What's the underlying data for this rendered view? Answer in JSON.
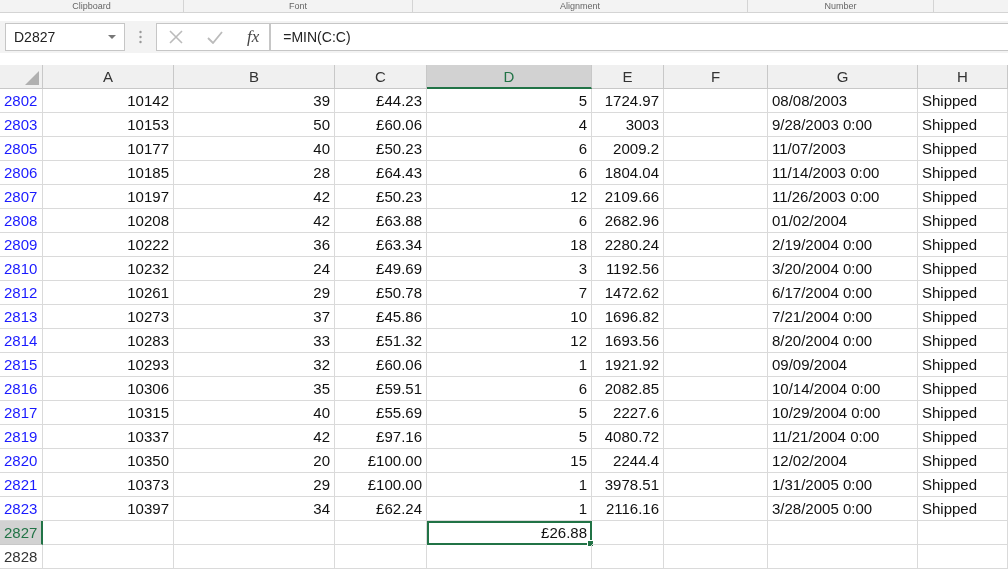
{
  "ribbon_groups": [
    "Clipboard",
    "Font",
    "Alignment",
    "Number"
  ],
  "formula_bar": {
    "name_box": "D2827",
    "function_label": "fx",
    "formula": "=MIN(C:C)"
  },
  "columns": [
    {
      "label": "A",
      "kind": "number",
      "selected": false
    },
    {
      "label": "B",
      "kind": "number",
      "selected": false
    },
    {
      "label": "C",
      "kind": "number",
      "selected": false
    },
    {
      "label": "D",
      "kind": "number",
      "selected": true
    },
    {
      "label": "E",
      "kind": "number",
      "selected": false
    },
    {
      "label": "F",
      "kind": "number",
      "selected": false
    },
    {
      "label": "G",
      "kind": "text",
      "selected": false
    },
    {
      "label": "H",
      "kind": "text",
      "selected": false
    }
  ],
  "rows": [
    {
      "header": "2802",
      "filtered": true,
      "selected": false,
      "cells": [
        "10142",
        "39",
        "£44.23",
        "5",
        "1724.97",
        null,
        "08/08/2003",
        "Shipped"
      ]
    },
    {
      "header": "2803",
      "filtered": true,
      "selected": false,
      "cells": [
        "10153",
        "50",
        "£60.06",
        "4",
        "3003",
        null,
        "9/28/2003 0:00",
        "Shipped"
      ]
    },
    {
      "header": "2805",
      "filtered": true,
      "selected": false,
      "cells": [
        "10177",
        "40",
        "£50.23",
        "6",
        "2009.2",
        null,
        "11/07/2003",
        "Shipped"
      ]
    },
    {
      "header": "2806",
      "filtered": true,
      "selected": false,
      "cells": [
        "10185",
        "28",
        "£64.43",
        "6",
        "1804.04",
        null,
        "11/14/2003 0:00",
        "Shipped"
      ]
    },
    {
      "header": "2807",
      "filtered": true,
      "selected": false,
      "cells": [
        "10197",
        "42",
        "£50.23",
        "12",
        "2109.66",
        null,
        "11/26/2003 0:00",
        "Shipped"
      ]
    },
    {
      "header": "2808",
      "filtered": true,
      "selected": false,
      "cells": [
        "10208",
        "42",
        "£63.88",
        "6",
        "2682.96",
        null,
        "01/02/2004",
        "Shipped"
      ]
    },
    {
      "header": "2809",
      "filtered": true,
      "selected": false,
      "cells": [
        "10222",
        "36",
        "£63.34",
        "18",
        "2280.24",
        null,
        "2/19/2004 0:00",
        "Shipped"
      ]
    },
    {
      "header": "2810",
      "filtered": true,
      "selected": false,
      "cells": [
        "10232",
        "24",
        "£49.69",
        "3",
        "1192.56",
        null,
        "3/20/2004 0:00",
        "Shipped"
      ]
    },
    {
      "header": "2812",
      "filtered": true,
      "selected": false,
      "cells": [
        "10261",
        "29",
        "£50.78",
        "7",
        "1472.62",
        null,
        "6/17/2004 0:00",
        "Shipped"
      ]
    },
    {
      "header": "2813",
      "filtered": true,
      "selected": false,
      "cells": [
        "10273",
        "37",
        "£45.86",
        "10",
        "1696.82",
        null,
        "7/21/2004 0:00",
        "Shipped"
      ]
    },
    {
      "header": "2814",
      "filtered": true,
      "selected": false,
      "cells": [
        "10283",
        "33",
        "£51.32",
        "12",
        "1693.56",
        null,
        "8/20/2004 0:00",
        "Shipped"
      ]
    },
    {
      "header": "2815",
      "filtered": true,
      "selected": false,
      "cells": [
        "10293",
        "32",
        "£60.06",
        "1",
        "1921.92",
        null,
        "09/09/2004",
        "Shipped"
      ]
    },
    {
      "header": "2816",
      "filtered": true,
      "selected": false,
      "cells": [
        "10306",
        "35",
        "£59.51",
        "6",
        "2082.85",
        null,
        "10/14/2004 0:00",
        "Shipped"
      ]
    },
    {
      "header": "2817",
      "filtered": true,
      "selected": false,
      "cells": [
        "10315",
        "40",
        "£55.69",
        "5",
        "2227.6",
        null,
        "10/29/2004 0:00",
        "Shipped"
      ]
    },
    {
      "header": "2819",
      "filtered": true,
      "selected": false,
      "cells": [
        "10337",
        "42",
        "£97.16",
        "5",
        "4080.72",
        null,
        "11/21/2004 0:00",
        "Shipped"
      ]
    },
    {
      "header": "2820",
      "filtered": true,
      "selected": false,
      "cells": [
        "10350",
        "20",
        "£100.00",
        "15",
        "2244.4",
        null,
        "12/02/2004",
        "Shipped"
      ]
    },
    {
      "header": "2821",
      "filtered": true,
      "selected": false,
      "cells": [
        "10373",
        "29",
        "£100.00",
        "1",
        "3978.51",
        null,
        "1/31/2005 0:00",
        "Shipped"
      ]
    },
    {
      "header": "2823",
      "filtered": true,
      "selected": false,
      "cells": [
        "10397",
        "34",
        "£62.24",
        "1",
        "2116.16",
        null,
        "3/28/2005 0:00",
        "Shipped"
      ]
    },
    {
      "header": "2827",
      "filtered": false,
      "selected": true,
      "cells": [
        null,
        null,
        null,
        "£26.88",
        null,
        null,
        null,
        null
      ]
    },
    {
      "header": "2828",
      "filtered": false,
      "selected": false,
      "cells": [
        null,
        null,
        null,
        null,
        null,
        null,
        null,
        null
      ]
    }
  ]
}
